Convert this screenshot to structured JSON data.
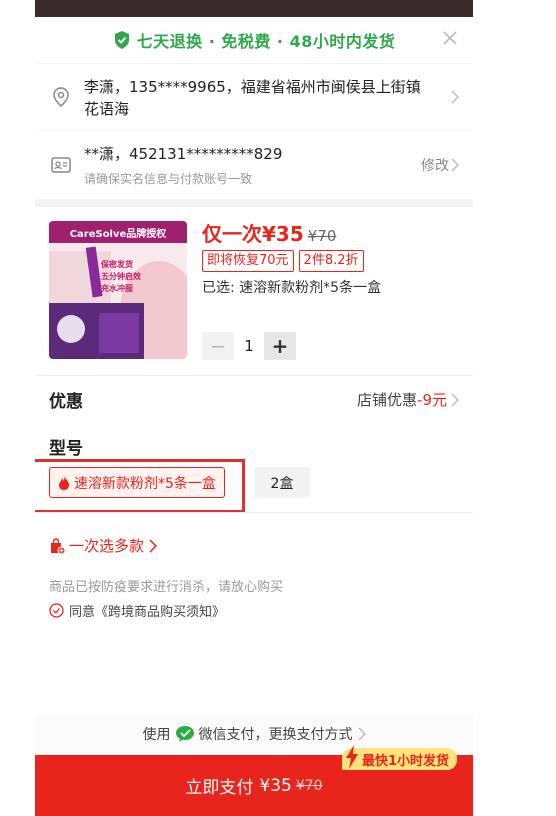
{
  "banner": {
    "text": "七天退换 · 免税费 · 48小时内发货"
  },
  "address": {
    "line": "李潇，135****9965，福建省福州市闽侯县上街镇花语海"
  },
  "identity": {
    "value": "**潇，452131*********829",
    "hint": "请确保实名信息与付款账号一致",
    "modify_label": "修改"
  },
  "product": {
    "image_brand_text": "CareSolve品牌授权",
    "image_lines": [
      "保密发货",
      "五分钟启效",
      "充水冲服"
    ],
    "price_prefix": "仅一次",
    "price": "¥35",
    "original_price": "¥70",
    "tags": [
      "即将恢复70元",
      "2件8.2折"
    ],
    "selected_text": "已选: 速溶新款粉剂*5条一盒",
    "quantity": "1",
    "minus": "−",
    "plus": "+"
  },
  "promo": {
    "label": "优惠",
    "detail": "店铺优惠",
    "amount": "-9元"
  },
  "model": {
    "label": "型号",
    "options": [
      "速溶新款粉剂*5条一盒",
      "2盒"
    ],
    "selected_index": 0
  },
  "multi_select": {
    "label": "一次选多款"
  },
  "notice": {
    "text": "商品已按防疫要求进行消杀，请放心购买",
    "agree": "同意《跨境商品购买须知》"
  },
  "payment": {
    "prefix": "使用",
    "method": "微信支付，更换支付方式"
  },
  "buy": {
    "label": "立即支付",
    "price": "¥35",
    "old_price": "¥70",
    "badge": "最快1小时发货"
  },
  "colors": {
    "accent_red": "#e8251d",
    "banner_green": "#2fa84b",
    "wechat_green": "#2aae3c"
  }
}
